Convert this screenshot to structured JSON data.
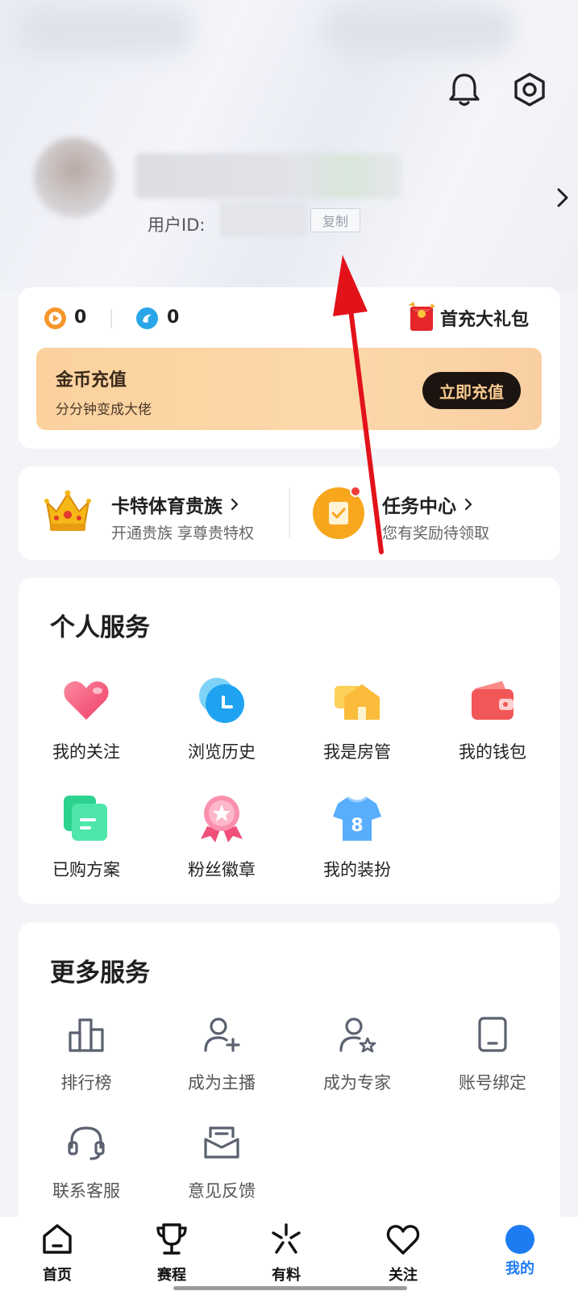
{
  "header": {
    "notification_icon": "bell-icon",
    "settings_icon": "hexagon-gear-icon"
  },
  "profile": {
    "uid_label": "用户ID:",
    "copy_label": "复制",
    "chevron": "›"
  },
  "wallet": {
    "coin_value": "0",
    "diamond_value": "0",
    "gift_label": "首充大礼包",
    "recharge_title": "金币充值",
    "recharge_subtitle": "分分钟变成大佬",
    "recharge_button": "立即充值"
  },
  "promo": {
    "vip_title": "卡特体育贵族",
    "vip_subtitle": "开通贵族 享尊贵特权",
    "task_title": "任务中心",
    "task_subtitle": "您有奖励待领取"
  },
  "personal": {
    "title": "个人服务",
    "items": [
      {
        "label": "我的关注",
        "icon": "heart-icon"
      },
      {
        "label": "浏览历史",
        "icon": "clock-icon"
      },
      {
        "label": "我是房管",
        "icon": "house-icon"
      },
      {
        "label": "我的钱包",
        "icon": "wallet-icon"
      },
      {
        "label": "已购方案",
        "icon": "document-icon"
      },
      {
        "label": "粉丝徽章",
        "icon": "badge-icon"
      },
      {
        "label": "我的装扮",
        "icon": "jersey-icon"
      }
    ]
  },
  "more": {
    "title": "更多服务",
    "items": [
      {
        "label": "排行榜",
        "icon": "bar-chart-icon"
      },
      {
        "label": "成为主播",
        "icon": "add-user-icon"
      },
      {
        "label": "成为专家",
        "icon": "user-star-icon"
      },
      {
        "label": "账号绑定",
        "icon": "tablet-icon"
      },
      {
        "label": "联系客服",
        "icon": "headset-icon"
      },
      {
        "label": "意见反馈",
        "icon": "mail-icon"
      }
    ]
  },
  "tabbar": {
    "tabs": [
      {
        "label": "首页",
        "icon": "home-icon"
      },
      {
        "label": "赛程",
        "icon": "trophy-icon"
      },
      {
        "label": "有料",
        "icon": "sparkle-icon"
      },
      {
        "label": "关注",
        "icon": "heart-outline-icon"
      },
      {
        "label": "我的",
        "icon": "profile-icon",
        "active": true
      }
    ]
  },
  "colors": {
    "accent_blue": "#1e7cf2",
    "annotation_red": "#e3121a",
    "recharge_bg": "#fbd29e"
  }
}
